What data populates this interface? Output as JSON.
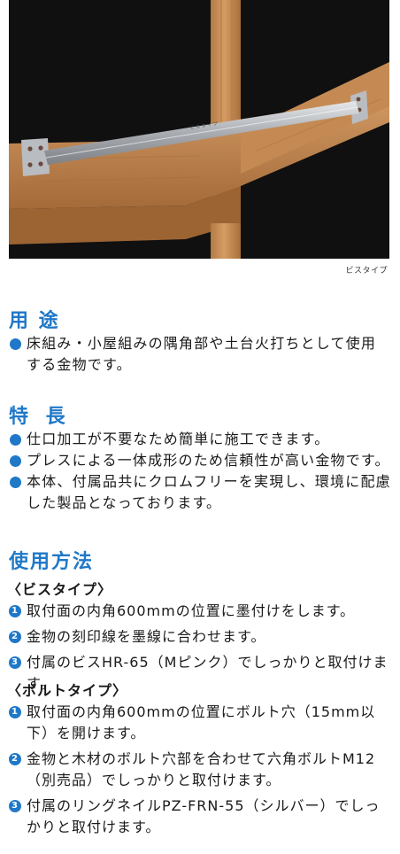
{
  "photo": {
    "caption": "ビスタイプ",
    "bar_marking": "ビ ス タ イ プ",
    "colors": {
      "background": "#101010",
      "wood": "#c98d55",
      "steel": "#b9bcc0"
    }
  },
  "usage": {
    "title": "用 途",
    "items": [
      "床組み・小屋組みの隅角部や土台火打ちとして使用する金物です。"
    ]
  },
  "features": {
    "title": "特 長",
    "items": [
      "仕口加工が不要なため簡単に施工できます。",
      "プレスによる一体成形のため信頼性が高い金物です。",
      "本体、付属品共にクロムフリーを実現し、環境に配慮した製品となっております。"
    ]
  },
  "method": {
    "title": "使用方法",
    "screw_type": {
      "heading": "〈ビスタイプ〉",
      "steps": [
        {
          "num": "1",
          "text": "取付面の内角600mmの位置に墨付けをします。"
        },
        {
          "num": "2",
          "text": "金物の刻印線を墨線に合わせます。"
        },
        {
          "num": "3",
          "text": "付属のビスHR-65（Mピンク）でしっかりと取付けます。"
        }
      ]
    },
    "bolt_type": {
      "heading": "〈ボルトタイプ〉",
      "steps": [
        {
          "num": "1",
          "text": "取付面の内角600mmの位置にボルト穴（15mm以下）を開けます。"
        },
        {
          "num": "2",
          "text": "金物と木材のボルト穴部を合わせて六角ボルトM12（別売品）でしっかりと取付けます。"
        },
        {
          "num": "3",
          "text": "付属のリングネイルPZ-FRN-55（シルバー）でしっかりと取付けます。"
        }
      ]
    }
  },
  "accent_color": "#1f78c8"
}
